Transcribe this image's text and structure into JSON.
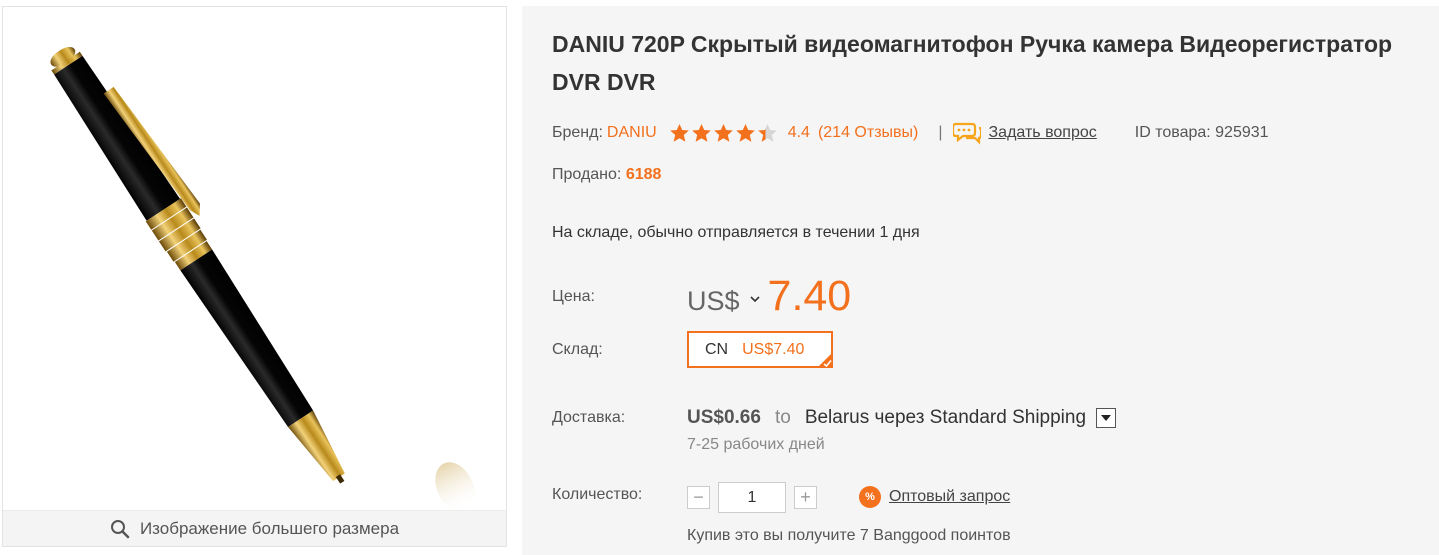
{
  "gallery": {
    "zoom_label": "Изображение большего размера",
    "zoom_icon": "search-icon"
  },
  "product": {
    "title": "DANIU 720P Скрытый видеомагнитофон Ручка камера Видеорегистратор DVR DVR",
    "brand_label": "Бренд:",
    "brand_value": "DANIU",
    "rating_value": 4.4,
    "rating_text": "4.4",
    "reviews_text": "(214 Отзывы)",
    "separator": "|",
    "ask_label": "Задать вопрос",
    "product_id_text": "ID товара: 925931",
    "sold_label": "Продано:",
    "sold_value": "6188",
    "stock_text": "На складе, обычно отправляется в течении 1 дня"
  },
  "price": {
    "label": "Цена:",
    "currency": "US$",
    "value": "7.40"
  },
  "warehouse": {
    "label": "Склад:",
    "code": "CN",
    "price": "US$7.40"
  },
  "shipping": {
    "label": "Доставка:",
    "cost": "US$0.66",
    "to": "to",
    "destination": "Belarus через Standard Shipping",
    "days": "7-25 рабочих дней"
  },
  "quantity": {
    "label": "Количество:",
    "value": "1",
    "minus": "−",
    "plus": "+"
  },
  "wholesale": {
    "badge": "%",
    "label": "Оптовый запрос"
  },
  "points_text": "Купив это вы получите 7 Banggood поинтов",
  "colors": {
    "accent": "#f3701d",
    "panel_bg": "#f5f5f5"
  }
}
